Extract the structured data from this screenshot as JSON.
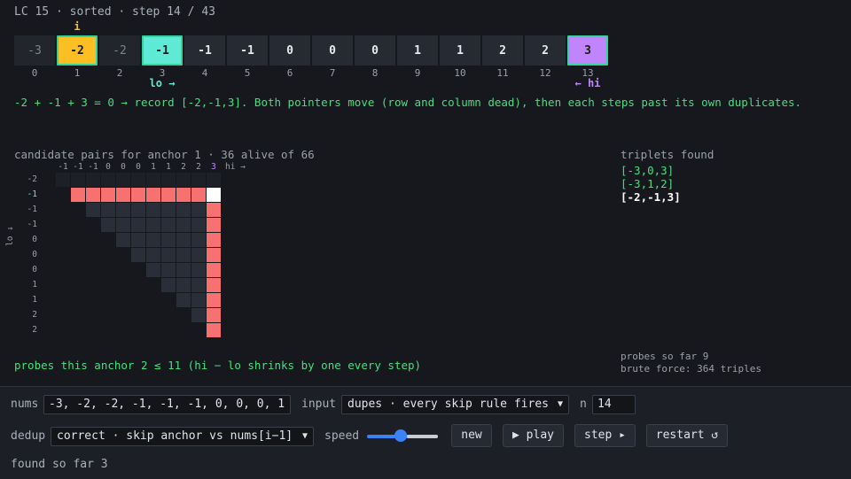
{
  "header": "LC 15 · sorted · step 14 / 43",
  "array": {
    "values": [
      "-3",
      "-2",
      "-2",
      "-1",
      "-1",
      "-1",
      "0",
      "0",
      "0",
      "1",
      "1",
      "2",
      "2",
      "3"
    ],
    "indices": [
      "0",
      "1",
      "2",
      "3",
      "4",
      "5",
      "6",
      "7",
      "8",
      "9",
      "10",
      "11",
      "12",
      "13"
    ],
    "anchor_label": "i",
    "lo_label": "lo →",
    "hi_label": "← hi",
    "colors": {
      "anchor": "#fbbf24",
      "lo": "#5eead4",
      "hi": "#c084fc",
      "border": "#34d399"
    }
  },
  "message": "-2 + -1 + 3 = 0 → record [-2,-1,3]. Both pointers move (row and column dead), then each steps past its own duplicates.",
  "grid": {
    "title": "candidate pairs for anchor 1 · 36 alive of 66",
    "col_labels": [
      "-1",
      "-1",
      "-1",
      "0",
      "0",
      "0",
      "1",
      "1",
      "2",
      "2",
      "3"
    ],
    "hi_axis": "hi →",
    "row_labels": [
      "-2",
      "-1",
      "-1",
      "-1",
      "0",
      "0",
      "0",
      "1",
      "1",
      "2",
      "2"
    ],
    "lo_axis": "lo ↓",
    "probes_anchor": "probes this anchor 2 ≤ 11 (hi − lo shrinks by one every step)"
  },
  "triplets": {
    "title": "triplets found",
    "items": [
      "[-3,0,3]",
      "[-3,1,2]",
      "[-2,-1,3]"
    ]
  },
  "stats": {
    "probes": "probes so far 9",
    "brute": "brute force: 364 triples"
  },
  "controls": {
    "nums_label": "nums",
    "nums_value": "-3, -2, -2, -1, -1, -1, 0, 0, 0, 1",
    "input_label": "input",
    "input_value": "dupes · every skip rule fires",
    "n_label": "n",
    "n_value": "14",
    "dedup_label": "dedup",
    "dedup_value": "correct · skip anchor vs nums[i−1]",
    "speed_label": "speed",
    "speed_level": 0.45,
    "new_label": "new",
    "play_label": "▶ play",
    "step_label": "step ▸",
    "restart_label": "restart ↺",
    "found": "found so far 3"
  }
}
